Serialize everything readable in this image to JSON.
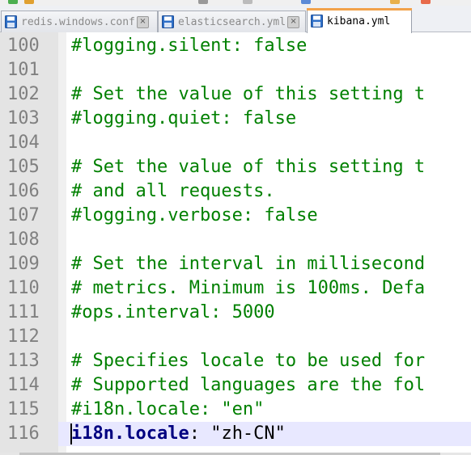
{
  "tabs": [
    {
      "label": "redis.windows.conf",
      "active": false,
      "icon": "save-disk-icon",
      "close_glyph": "×"
    },
    {
      "label": "elasticsearch.yml",
      "active": false,
      "icon": "save-disk-icon",
      "close_glyph": "×"
    },
    {
      "label": "kibana.yml",
      "active": true,
      "icon": "save-disk-icon"
    }
  ],
  "editor": {
    "current_line": 116,
    "lines": [
      {
        "number": "100",
        "text": "#logging.silent: false"
      },
      {
        "number": "101",
        "text": ""
      },
      {
        "number": "102",
        "text": "# Set the value of this setting t"
      },
      {
        "number": "103",
        "text": "#logging.quiet: false"
      },
      {
        "number": "104",
        "text": ""
      },
      {
        "number": "105",
        "text": "# Set the value of this setting t"
      },
      {
        "number": "106",
        "text": "# and all requests."
      },
      {
        "number": "107",
        "text": "#logging.verbose: false"
      },
      {
        "number": "108",
        "text": ""
      },
      {
        "number": "109",
        "text": "# Set the interval in millisecond"
      },
      {
        "number": "110",
        "text": "# metrics. Minimum is 100ms. Defa"
      },
      {
        "number": "111",
        "text": "#ops.interval: 5000"
      },
      {
        "number": "112",
        "text": ""
      },
      {
        "number": "113",
        "text": "# Specifies locale to be used for"
      },
      {
        "number": "114",
        "text": "# Supported languages are the fol"
      },
      {
        "number": "115",
        "text": "#i18n.locale: \"en\""
      },
      {
        "number": "116",
        "key": "i18n.locale",
        "sep": ":",
        "value": " \"zh-CN\""
      }
    ]
  },
  "colors": {
    "comment": "#008000",
    "key": "#000080",
    "line_number": "#808080",
    "gutter_bg": "#e4e4e4",
    "current_line_bg": "#e8e8ff",
    "active_tab_accent": "#f2a24a",
    "save_icon": "#2e6fc7"
  }
}
